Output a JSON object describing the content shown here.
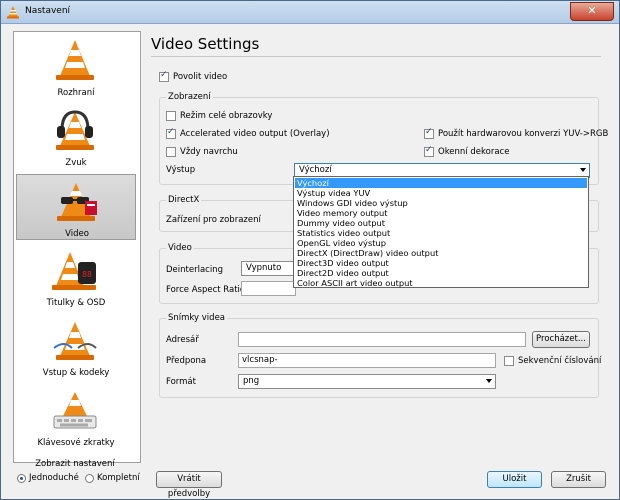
{
  "window": {
    "title": "Nastavení",
    "close_glyph": "✕"
  },
  "sidebar": {
    "items": [
      {
        "label": "Rozhraní",
        "icon": "cone-interface-icon"
      },
      {
        "label": "Zvuk",
        "icon": "cone-headphones-icon"
      },
      {
        "label": "Video",
        "icon": "cone-glasses-icon"
      },
      {
        "label": "Titulky & OSD",
        "icon": "cone-clock-icon"
      },
      {
        "label": "Vstup & kodeky",
        "icon": "cone-cables-icon"
      },
      {
        "label": "Klávesové zkratky",
        "icon": "cone-keyboard-icon"
      }
    ],
    "selected": "Video"
  },
  "mode": {
    "title": "Zobrazit nastavení",
    "simple": "Jednoduché",
    "advanced": "Kompletní",
    "selected": "Jednoduché"
  },
  "page": {
    "title": "Video Settings",
    "enable_video": "Povolit video",
    "display_group": {
      "title": "Zobrazení",
      "fullscreen": "Režim celé obrazovky",
      "accelerated": "Accelerated video output (Overlay)",
      "always_on_top": "Vždy navrchu",
      "yuv_rgb": "Použít hardwarovou konverzi YUV->RGB",
      "decorations": "Okenní dekorace",
      "output_label": "Výstup",
      "output_value": "Výchozí",
      "options": [
        "Výchozí",
        "Výstup videa YUV",
        "Windows GDI video výstup",
        "Video memory output",
        "Dummy video output",
        "Statistics video output",
        "OpenGL video výstup",
        "DirectX (DirectDraw) video output",
        "Direct3D video output",
        "Direct2D video output",
        "Color ASCII art video output"
      ]
    },
    "directx_group": {
      "title": "DirectX",
      "device_label": "Zařízení pro zobrazení"
    },
    "video_group": {
      "title": "Video",
      "deinterlacing_label": "Deinterlacing",
      "deinterlacing_value": "Vypnuto",
      "aspect_label": "Force Aspect Ratio"
    },
    "snapshots_group": {
      "title": "Snímky videa",
      "address_label": "Adresář",
      "browse_button": "Procházet...",
      "prefix_label": "Předpona",
      "prefix_value": "vlcsnap-",
      "sequential_label": "Sekvenční číslování",
      "format_label": "Formát",
      "format_value": "png"
    }
  },
  "footer": {
    "reset": "Vrátit předvolby",
    "save": "Uložit",
    "cancel": "Zrušit"
  }
}
